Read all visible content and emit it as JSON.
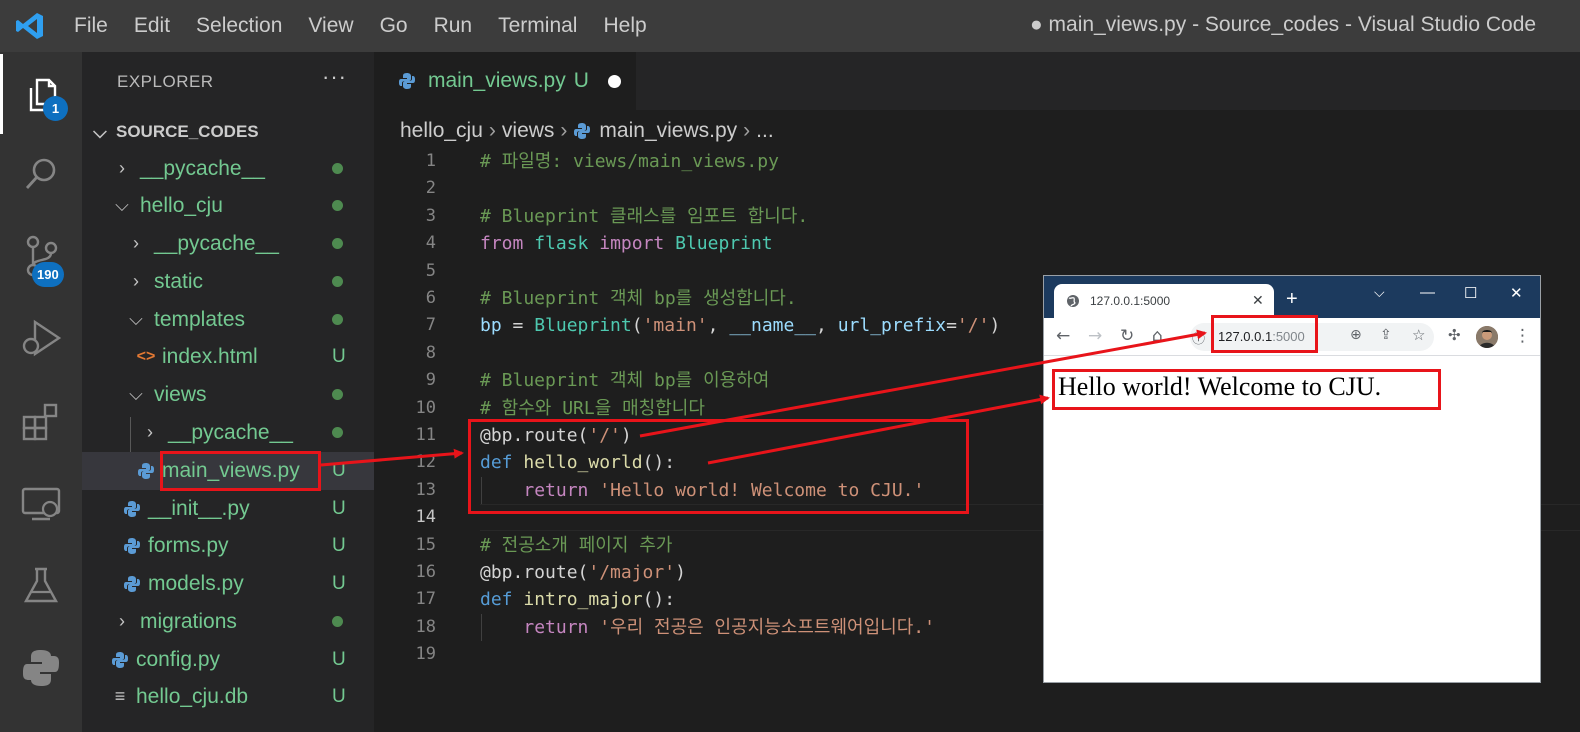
{
  "window": {
    "title": "● main_views.py - Source_codes - Visual Studio Code"
  },
  "menu": [
    "File",
    "Edit",
    "Selection",
    "View",
    "Go",
    "Run",
    "Terminal",
    "Help"
  ],
  "activity_bar": {
    "explorer_badge": "1",
    "source_control_badge": "190",
    "items": [
      "files-icon",
      "search-icon",
      "source-control-icon",
      "run-debug-icon",
      "extensions-icon",
      "remote-explorer-icon",
      "testing-icon",
      "python-icon"
    ]
  },
  "sidebar": {
    "title": "EXPLORER",
    "more": "···",
    "root": "SOURCE_CODES",
    "tree": [
      {
        "label": "__pycache__",
        "type": "folder",
        "status": "dot"
      },
      {
        "label": "hello_cju",
        "type": "folder-open",
        "status": "dot"
      },
      {
        "label": "__pycache__",
        "type": "folder",
        "status": "dot"
      },
      {
        "label": "static",
        "type": "folder",
        "status": "dot"
      },
      {
        "label": "templates",
        "type": "folder-open",
        "status": "dot"
      },
      {
        "label": "index.html",
        "type": "html",
        "status": "U"
      },
      {
        "label": "views",
        "type": "folder-open",
        "status": "dot"
      },
      {
        "label": "__pycache__",
        "type": "folder",
        "status": "dot"
      },
      {
        "label": "main_views.py",
        "type": "python",
        "status": "U"
      },
      {
        "label": "__init__.py",
        "type": "python",
        "status": "U"
      },
      {
        "label": "forms.py",
        "type": "python",
        "status": "U"
      },
      {
        "label": "models.py",
        "type": "python",
        "status": "U"
      },
      {
        "label": "migrations",
        "type": "folder",
        "status": "dot"
      },
      {
        "label": "config.py",
        "type": "python",
        "status": "U"
      },
      {
        "label": "hello_cju.db",
        "type": "db",
        "status": "U"
      }
    ]
  },
  "editor": {
    "tab": {
      "label": "main_views.py",
      "status": "U"
    },
    "breadcrumb": [
      "hello_cju",
      "views",
      "main_views.py",
      "..."
    ],
    "line_numbers": [
      "1",
      "2",
      "3",
      "4",
      "5",
      "6",
      "7",
      "8",
      "9",
      "10",
      "11",
      "12",
      "13",
      "14",
      "15",
      "16",
      "17",
      "18",
      "19"
    ],
    "code": {
      "l1": "# 파일명: views/main_views.py",
      "l3": "# Blueprint 클래스를 임포트 합니다.",
      "l4_from": "from",
      "l4_mod": "flask",
      "l4_import": "import",
      "l4_cls": "Blueprint",
      "l6": "# Blueprint 객체 bp를 생성합니다.",
      "l7_var": "bp",
      "l7_eq": " = ",
      "l7_cls": "Blueprint",
      "l7_p1": "(",
      "l7_s1": "'main'",
      "l7_c1": ", ",
      "l7_name": "__name__",
      "l7_c2": ", ",
      "l7_kw": "url_prefix",
      "l7_eq2": "=",
      "l7_s2": "'/'",
      "l7_p2": ")",
      "l9": "# Blueprint 객체 bp를 이용하여",
      "l10": "# 함수와 URL을 매칭합니다",
      "l11_at": "@bp.route(",
      "l11_s": "'/'",
      "l11_p": ")",
      "l12_def": "def",
      "l12_fn": "hello_world",
      "l12_p": "():",
      "l13_ret": "return",
      "l13_s": "'Hello world! Welcome to CJU.'",
      "l15": "# 전공소개 페이지 추가",
      "l16_at": "@bp.route(",
      "l16_s": "'/major'",
      "l16_p": ")",
      "l17_def": "def",
      "l17_fn": "intro_major",
      "l17_p": "():",
      "l18_ret": "return",
      "l18_s": "'우리 전공은 인공지능소프트웨어입니다.'"
    }
  },
  "browser": {
    "tab_title": "127.0.0.1:5000",
    "url_host": "127.0.0.1",
    "url_port": ":5000",
    "new_tab": "+",
    "page_text": "Hello world! Welcome to CJU."
  },
  "colors": {
    "annotation": "#e8141a",
    "accent": "#0e70c0",
    "git_untracked": "#73c991"
  }
}
